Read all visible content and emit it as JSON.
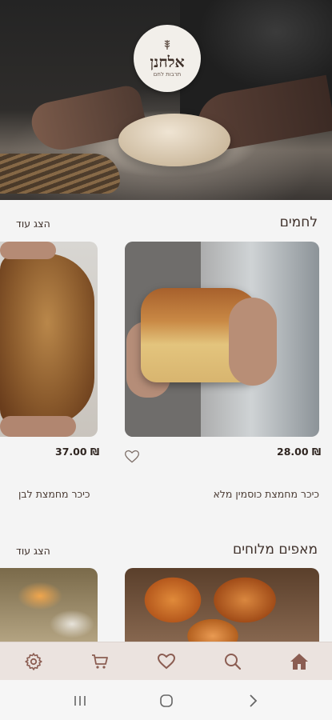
{
  "brand": {
    "name": "אלחנן",
    "tagline": "תרבות לחם",
    "logo_icon": "wheat-icon"
  },
  "sections": [
    {
      "title": "לחמים",
      "show_more": "הצג עוד",
      "products": [
        {
          "name": "כיכר מחמצת כוסמין מלא",
          "price": "28.00 ₪",
          "heart_icon": "heart-outline-icon"
        },
        {
          "name": "כיכר מחמצת לבן",
          "price": "37.00 ₪"
        }
      ]
    },
    {
      "title": "מאפים מלוחים",
      "show_more": "הצג עוד"
    }
  ],
  "bottom_nav": [
    {
      "id": "home",
      "icon": "home-icon",
      "active": true
    },
    {
      "id": "search",
      "icon": "search-icon",
      "active": false
    },
    {
      "id": "favorites",
      "icon": "heart-icon",
      "active": false
    },
    {
      "id": "cart",
      "icon": "cart-icon",
      "active": false
    },
    {
      "id": "settings",
      "icon": "gear-icon",
      "active": false
    }
  ],
  "system_nav": [
    "recents-icon",
    "home-circle-icon",
    "back-chevron-icon"
  ],
  "colors": {
    "accent": "#6b4438",
    "nav_bg": "#ebe3df",
    "nav_icon": "#8b5d52"
  }
}
